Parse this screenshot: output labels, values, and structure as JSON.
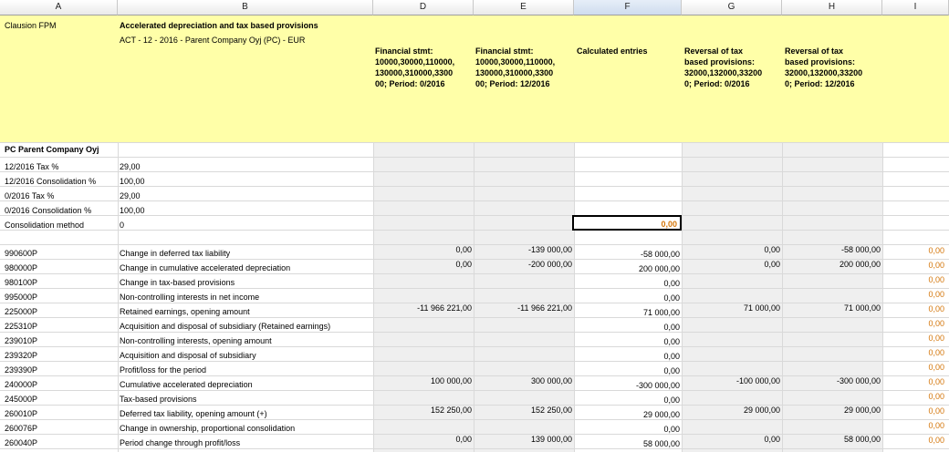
{
  "columns": [
    "A",
    "B",
    "D",
    "E",
    "F",
    "G",
    "H",
    "I"
  ],
  "header": {
    "a_title": "Clausion FPM",
    "b_title": "Accelerated depreciation and tax based provisions",
    "b_subtitle": "ACT - 12 - 2016 - Parent Company Oyj (PC) - EUR",
    "d": "Financial stmt:\n10000,30000,110000,\n130000,310000,3300\n00; Period: 0/2016",
    "e": "Financial stmt:\n10000,30000,110000,\n130000,310000,3300\n00; Period: 12/2016",
    "f": "Calculated entries",
    "g": "Reversal of tax\nbased provisions:\n32000,132000,33200\n0; Period: 0/2016",
    "h": "Reversal of tax\nbased provisions:\n32000,132000,33200\n0; Period:  12/2016"
  },
  "company": "PC Parent Company Oyj",
  "params": [
    {
      "label": "12/2016 Tax %",
      "value": "29,00"
    },
    {
      "label": "12/2016 Consolidation %",
      "value": "100,00"
    },
    {
      "label": "0/2016 Tax %",
      "value": "29,00"
    },
    {
      "label": "0/2016 Consolidation %",
      "value": "100,00"
    },
    {
      "label": "Consolidation method",
      "value": "0"
    }
  ],
  "selected_value": "0,00",
  "rows": [
    {
      "code": "990600P",
      "desc": "Change in deferred tax liability",
      "d": "0,00",
      "e": "-139 000,00",
      "f": "-58 000,00",
      "g": "0,00",
      "h": "-58 000,00",
      "i": "0,00"
    },
    {
      "code": "980000P",
      "desc": "Change in cumulative accelerated depreciation",
      "d": "0,00",
      "e": "-200 000,00",
      "f": "200 000,00",
      "g": "0,00",
      "h": "200 000,00",
      "i": "0,00"
    },
    {
      "code": "980100P",
      "desc": "Change in tax-based provisions",
      "d": "",
      "e": "",
      "f": "0,00",
      "g": "",
      "h": "",
      "i": "0,00"
    },
    {
      "code": "995000P",
      "desc": "Non-controlling interests in net income",
      "d": "",
      "e": "",
      "f": "0,00",
      "g": "",
      "h": "",
      "i": "0,00"
    },
    {
      "code": "225000P",
      "desc": "Retained earnings, opening amount",
      "d": "-11 966 221,00",
      "e": "-11 966 221,00",
      "f": "71 000,00",
      "g": "71 000,00",
      "h": "71 000,00",
      "i": "0,00"
    },
    {
      "code": "225310P",
      "desc": "Acquisition and disposal of subsidiary (Retained earnings)",
      "d": "",
      "e": "",
      "f": "0,00",
      "g": "",
      "h": "",
      "i": "0,00"
    },
    {
      "code": "239010P",
      "desc": "Non-controlling interests, opening amount",
      "d": "",
      "e": "",
      "f": "0,00",
      "g": "",
      "h": "",
      "i": "0,00"
    },
    {
      "code": "239320P",
      "desc": "Acquisition and disposal of subsidiary",
      "d": "",
      "e": "",
      "f": "0,00",
      "g": "",
      "h": "",
      "i": "0,00"
    },
    {
      "code": "239390P",
      "desc": "Profit/loss for the period",
      "d": "",
      "e": "",
      "f": "0,00",
      "g": "",
      "h": "",
      "i": "0,00"
    },
    {
      "code": "240000P",
      "desc": "Cumulative accelerated depreciation",
      "d": "100 000,00",
      "e": "300 000,00",
      "f": "-300 000,00",
      "g": "-100 000,00",
      "h": "-300 000,00",
      "i": "0,00"
    },
    {
      "code": "245000P",
      "desc": "Tax-based provisions",
      "d": "",
      "e": "",
      "f": "0,00",
      "g": "",
      "h": "",
      "i": "0,00"
    },
    {
      "code": "260010P",
      "desc": "Deferred tax liability, opening amount (+)",
      "d": "152 250,00",
      "e": "152 250,00",
      "f": "29 000,00",
      "g": "29 000,00",
      "h": "29 000,00",
      "i": "0,00"
    },
    {
      "code": "260076P",
      "desc": "Change in ownership, proportional consolidation",
      "d": "",
      "e": "",
      "f": "0,00",
      "g": "",
      "h": "",
      "i": "0,00"
    },
    {
      "code": "260040P",
      "desc": "Period change through profit/loss",
      "d": "0,00",
      "e": "139 000,00",
      "f": "58 000,00",
      "g": "0,00",
      "h": "58 000,00",
      "i": "0,00"
    }
  ]
}
